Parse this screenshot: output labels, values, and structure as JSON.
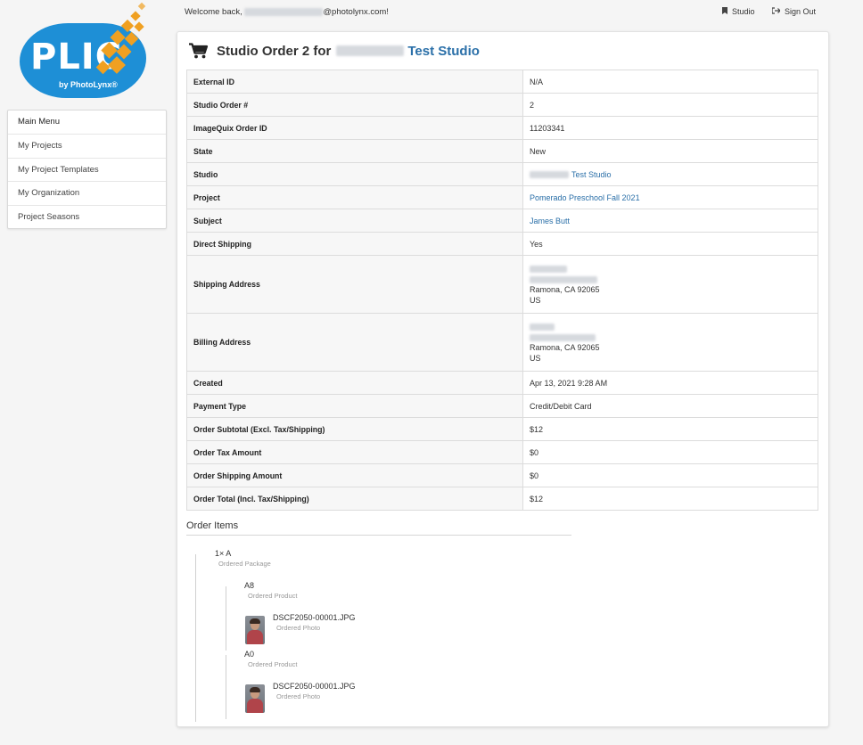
{
  "logo": {
    "text": "PLIC",
    "subtitle": "by PhotoLynx®"
  },
  "header": {
    "welcome_prefix": "Welcome back, ",
    "welcome_suffix": "@photolynx.com!",
    "studio_link": "Studio",
    "sign_out": "Sign Out"
  },
  "menu": {
    "items": [
      {
        "label": "Main Menu"
      },
      {
        "label": "My Projects"
      },
      {
        "label": "My Project Templates"
      },
      {
        "label": "My Organization"
      },
      {
        "label": "Project Seasons"
      }
    ]
  },
  "order": {
    "title_prefix": "Studio Order 2 for",
    "title_studio": "Test Studio",
    "rows": [
      {
        "label": "External ID",
        "value": "N/A"
      },
      {
        "label": "Studio Order #",
        "value": "2"
      },
      {
        "label": "ImageQuix Order ID",
        "value": "11203341"
      },
      {
        "label": "State",
        "value": "New"
      },
      {
        "label": "Studio",
        "value": "Test Studio"
      },
      {
        "label": "Project",
        "value": "Pomerado Preschool Fall 2021"
      },
      {
        "label": "Subject",
        "value": "James Butt"
      },
      {
        "label": "Direct Shipping",
        "value": "Yes"
      },
      {
        "label": "Shipping Address",
        "city": "Ramona, CA 92065",
        "country": "US"
      },
      {
        "label": "Billing Address",
        "city": "Ramona, CA 92065",
        "country": "US"
      },
      {
        "label": "Created",
        "value": "Apr 13, 2021 9:28 AM"
      },
      {
        "label": "Payment Type",
        "value": "Credit/Debit Card"
      },
      {
        "label": "Order Subtotal (Excl. Tax/Shipping)",
        "value": "$12"
      },
      {
        "label": "Order Tax Amount",
        "value": "$0"
      },
      {
        "label": "Order Shipping Amount",
        "value": "$0"
      },
      {
        "label": "Order Total (Incl. Tax/Shipping)",
        "value": "$12"
      }
    ]
  },
  "order_items": {
    "heading": "Order Items",
    "package": {
      "name": "1× A",
      "type": "Ordered Package"
    },
    "products": [
      {
        "name": "A8",
        "type": "Ordered Product",
        "photo": {
          "name": "DSCF2050-00001.JPG",
          "type": "Ordered Photo"
        }
      },
      {
        "name": "A0",
        "type": "Ordered Product",
        "photo": {
          "name": "DSCF2050-00001.JPG",
          "type": "Ordered Photo"
        }
      }
    ]
  },
  "colors": {
    "accent": "#2a6fa8",
    "logo_blue": "#1e8fd6",
    "logo_orange": "#f0a021"
  },
  "icons": {
    "cart": "shopping-cart-icon",
    "studio": "bookmark-icon",
    "sign_out": "sign-out-icon"
  }
}
